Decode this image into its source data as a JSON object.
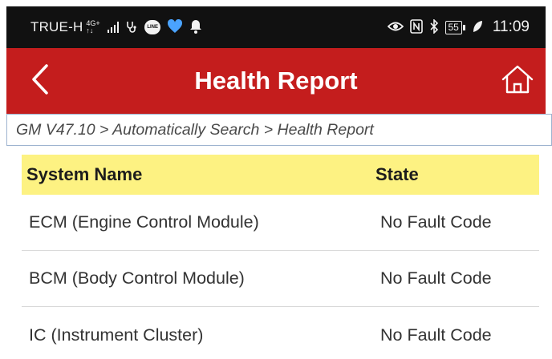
{
  "status_bar": {
    "carrier": "TRUE-H",
    "network_top": "4G+",
    "network_bottom": "↑↓",
    "battery": "55",
    "time": "11:09",
    "icons": [
      "stethoscope-icon",
      "line-icon",
      "heart-icon",
      "bell-icon",
      "eye-icon",
      "nfc-icon",
      "bluetooth-icon",
      "battery-icon",
      "leaf-icon"
    ]
  },
  "header": {
    "title": "Health Report",
    "back_icon": "chevron-left-icon",
    "home_icon": "home-icon"
  },
  "breadcrumb": {
    "text": "GM V47.10 > Automatically Search > Health Report"
  },
  "table": {
    "headers": {
      "name": "System Name",
      "state": "State"
    },
    "rows": [
      {
        "name": "ECM (Engine Control Module)",
        "state": "No Fault Code"
      },
      {
        "name": "BCM (Body Control Module)",
        "state": "No Fault Code"
      },
      {
        "name": "IC (Instrument Cluster)",
        "state": "No Fault Code"
      }
    ]
  },
  "colors": {
    "app_bar": "#c41d1d",
    "header_row": "#fdf282",
    "status_bar": "#111111"
  }
}
